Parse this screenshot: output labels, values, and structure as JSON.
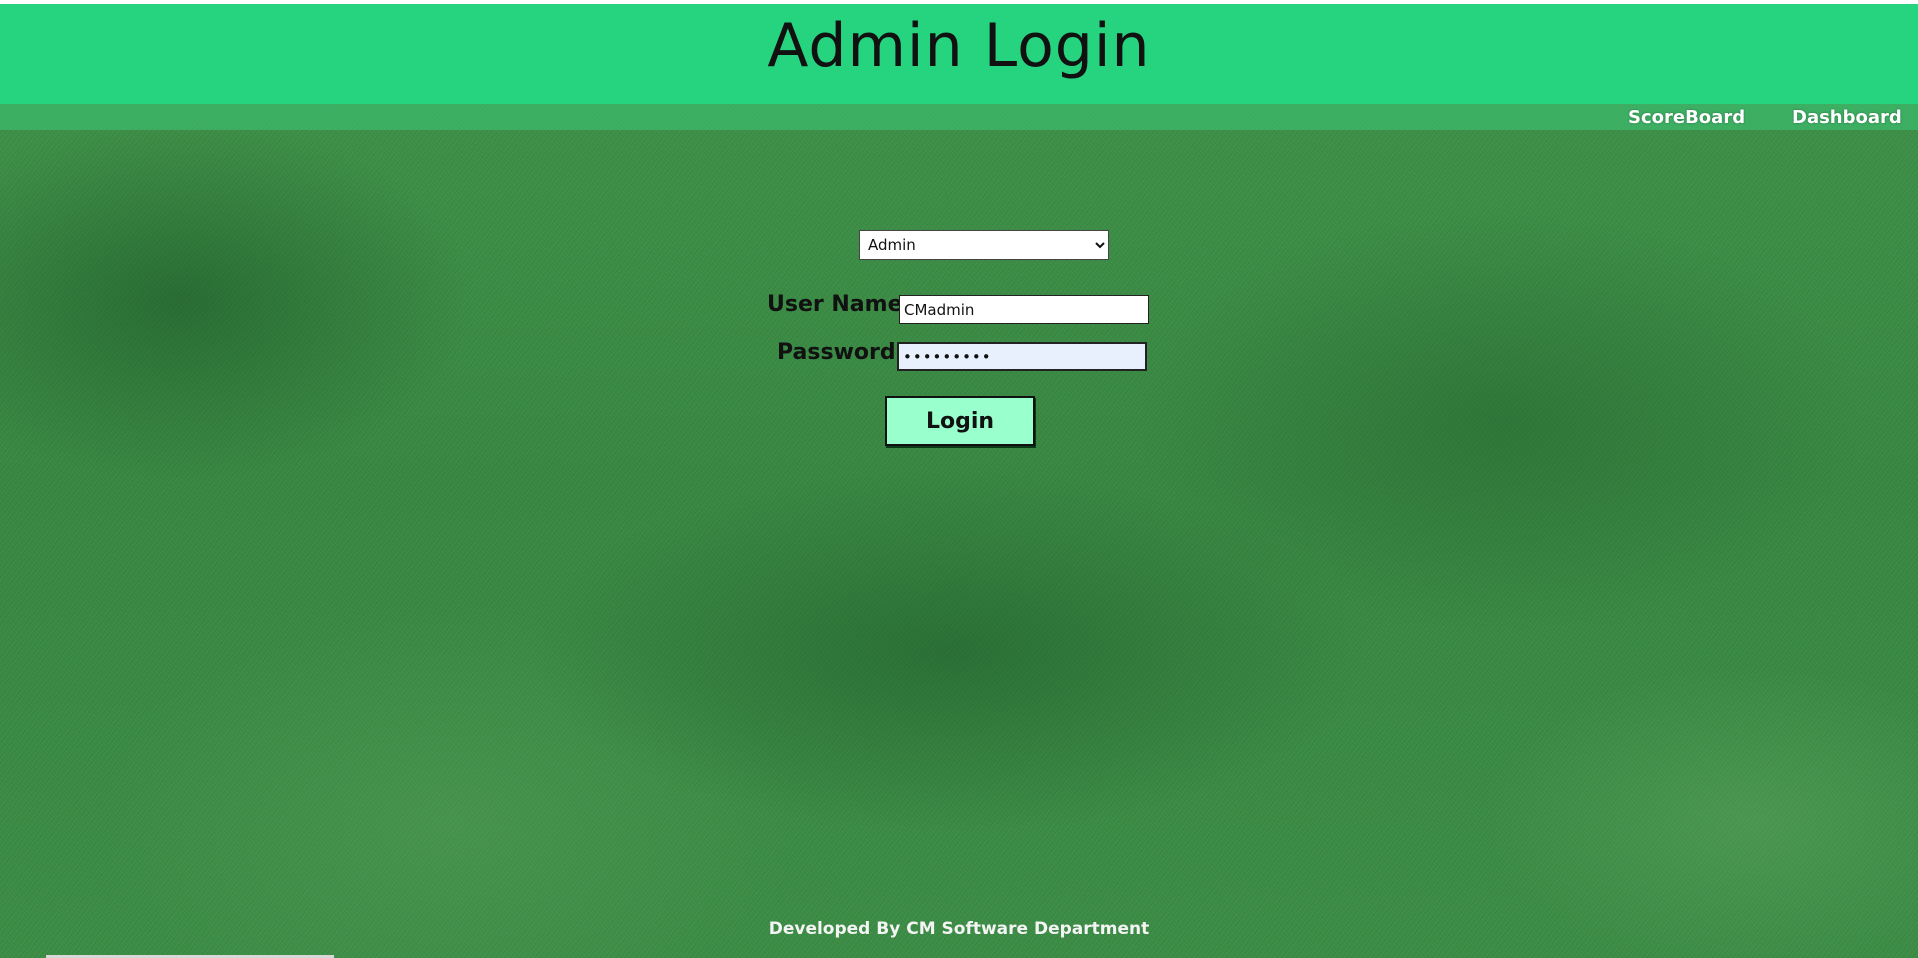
{
  "header": {
    "title": "Admin Login"
  },
  "nav": {
    "items": [
      {
        "label": "ScoreBoard"
      },
      {
        "label": "Dashboard"
      }
    ]
  },
  "login_form": {
    "role_select": {
      "selected": "Admin",
      "options": [
        "Admin"
      ]
    },
    "username": {
      "label": "User Name",
      "value": "CMadmin"
    },
    "password": {
      "label": "Password",
      "value": "•••••••••"
    },
    "submit_label": "Login"
  },
  "footer": {
    "text": "Developed By CM Software Department"
  },
  "colors": {
    "header_bg": "#26d47f",
    "button_bg": "#99ffcc",
    "password_field_bg": "#e8f0fe"
  }
}
